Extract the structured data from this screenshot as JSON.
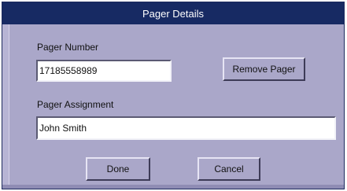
{
  "dialog": {
    "title": "Pager Details",
    "pager_number_label": "Pager Number",
    "pager_number_value": "17185558989",
    "remove_pager_label": "Remove Pager",
    "pager_assignment_label": "Pager Assignment",
    "pager_assignment_value": "John Smith",
    "done_label": "Done",
    "cancel_label": "Cancel"
  },
  "colors": {
    "title_bar": "#172a63",
    "dialog_background": "#aaa7c9"
  }
}
